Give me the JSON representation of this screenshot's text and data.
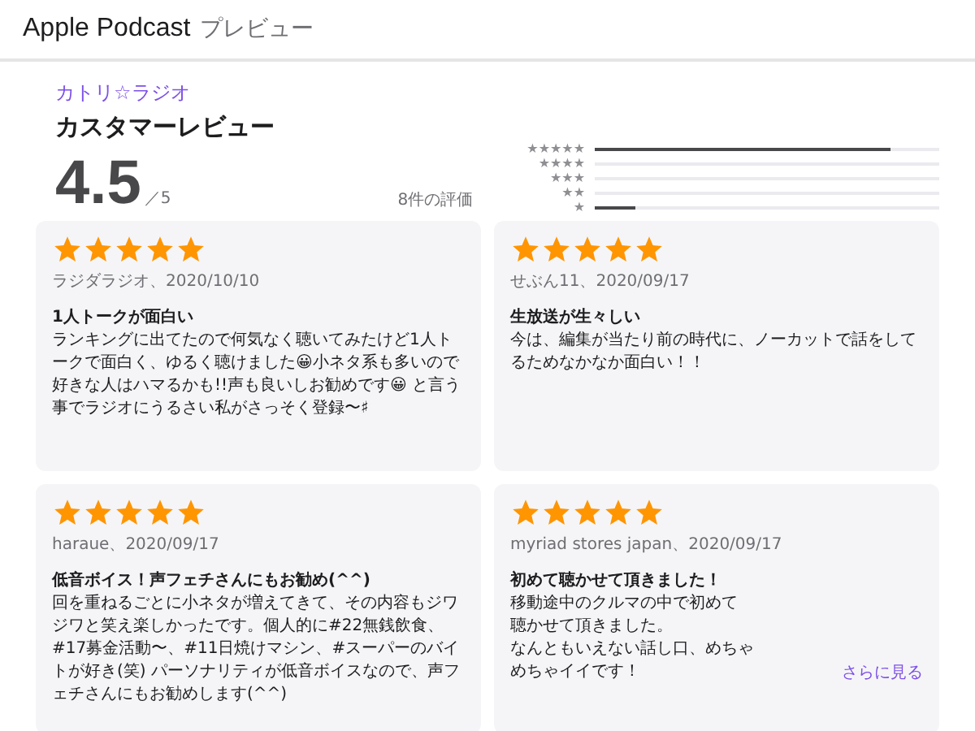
{
  "header": {
    "brand": "Apple Podcast",
    "subtitle": "プレビュー"
  },
  "podcast": "カトリ☆ラジオ",
  "section_title": "カスタマーレビュー",
  "rating": {
    "score": "4.5",
    "out_of": "／5",
    "count": "8件の評価"
  },
  "histogram": [
    {
      "label": "★★★★★",
      "level": 0.86
    },
    {
      "label": "★★★★"
    },
    {
      "label": "★★★"
    },
    {
      "label": "★★"
    },
    {
      "label": "★",
      "level": 0.12
    }
  ],
  "reviews": [
    {
      "stars": 5,
      "author": "ラジダラジオ、2020/10/10",
      "title": "1人トークが面白い",
      "body": [
        "ランキングに出てたので何気なく聴いてみたけど1人トークで面白く、ゆるく聴けました😀小ネタ系も多いので好きな人はハマるかも!!声も良いしお勧めです😀 と言う事でラジオにうるさい私がさっそく登録〜♯"
      ]
    },
    {
      "stars": 5,
      "author": "せぶん11、2020/09/17",
      "title": "生放送が生々しい",
      "body": [
        "今は、編集が当たり前の時代に、ノーカットで話をしてるためなかなか面白い！！"
      ]
    },
    {
      "stars": 5,
      "author": "haraue、2020/09/17",
      "title": "低音ボイス！声フェチさんにもお勧め(^^)",
      "body": [
        "回を重ねるごとに小ネタが増えてきて、その内容もジワジワと笑え楽しかったです。個人的に#22無銭飲食、#17募金活動〜、#11日焼けマシン、#スーパーのバイトが好き(笑) パーソナリティが低音ボイスなので、声フェチさんにもお勧めします(^^)"
      ]
    },
    {
      "stars": 5,
      "author": "myriad stores japan、2020/09/17",
      "title": "初めて聴かせて頂きました！",
      "body": [
        "移動途中のクルマの中で初めて",
        "聴かせて頂きました。",
        "なんともいえない話し口、めちゃ",
        "めちゃイイです！"
      ],
      "more": "さらに見る"
    }
  ]
}
